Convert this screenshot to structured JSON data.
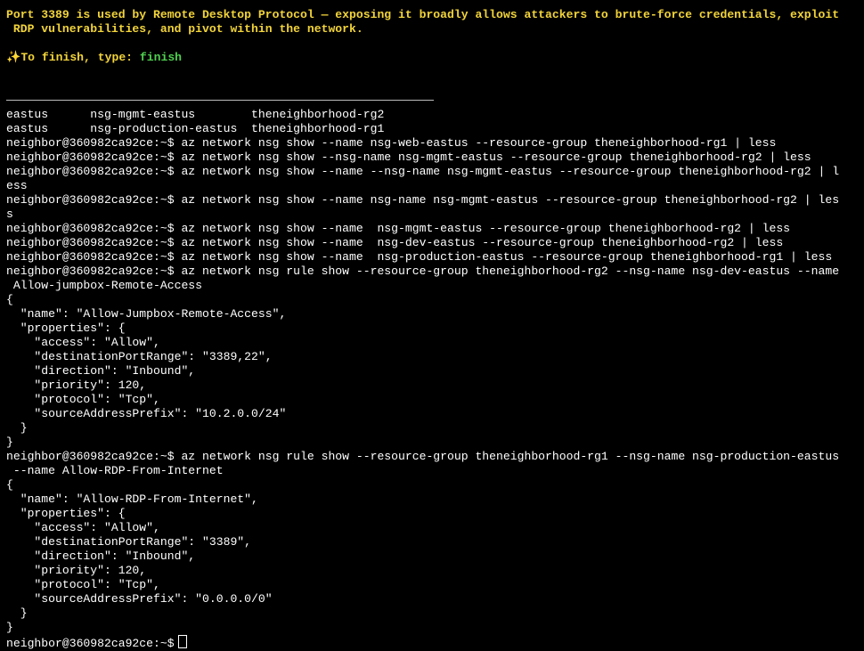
{
  "colors": {
    "background": "#000000",
    "banner_text": "#f2d43a",
    "finish_command": "#4fd04f",
    "output_text": "#ffffff"
  },
  "banner": {
    "message": "Port 3389 is used by Remote Desktop Protocol — exposing it broadly allows attackers to brute-force credentials, exploit\n RDP vulnerabilities, and pivot within the network.",
    "finish_icon": "✨",
    "finish_prefix": "To finish, type: ",
    "finish_command": "finish"
  },
  "terminal": {
    "lines": [
      "eastus      nsg-mgmt-eastus        theneighborhood-rg2",
      "eastus      nsg-production-eastus  theneighborhood-rg1",
      "neighbor@360982ca92ce:~$ az network nsg show --name nsg-web-eastus --resource-group theneighborhood-rg1 | less",
      "neighbor@360982ca92ce:~$ az network nsg show --nsg-name nsg-mgmt-eastus --resource-group theneighborhood-rg2 | less",
      "neighbor@360982ca92ce:~$ az network nsg show --name --nsg-name nsg-mgmt-eastus --resource-group theneighborhood-rg2 | l",
      "ess",
      "neighbor@360982ca92ce:~$ az network nsg show --name nsg-name nsg-mgmt-eastus --resource-group theneighborhood-rg2 | les",
      "s",
      "neighbor@360982ca92ce:~$ az network nsg show --name  nsg-mgmt-eastus --resource-group theneighborhood-rg2 | less",
      "neighbor@360982ca92ce:~$ az network nsg show --name  nsg-dev-eastus --resource-group theneighborhood-rg2 | less",
      "neighbor@360982ca92ce:~$ az network nsg show --name  nsg-production-eastus --resource-group theneighborhood-rg1 | less",
      "neighbor@360982ca92ce:~$ az network nsg rule show --resource-group theneighborhood-rg2 --nsg-name nsg-dev-eastus --name",
      " Allow-jumpbox-Remote-Access",
      "{",
      "  \"name\": \"Allow-Jumpbox-Remote-Access\",",
      "  \"properties\": {",
      "    \"access\": \"Allow\",",
      "    \"destinationPortRange\": \"3389,22\",",
      "    \"direction\": \"Inbound\",",
      "    \"priority\": 120,",
      "    \"protocol\": \"Tcp\",",
      "    \"sourceAddressPrefix\": \"10.2.0.0/24\"",
      "  }",
      "}",
      "neighbor@360982ca92ce:~$ az network nsg rule show --resource-group theneighborhood-rg1 --nsg-name nsg-production-eastus",
      " --name Allow-RDP-From-Internet",
      "{",
      "  \"name\": \"Allow-RDP-From-Internet\",",
      "  \"properties\": {",
      "    \"access\": \"Allow\",",
      "    \"destinationPortRange\": \"3389\",",
      "    \"direction\": \"Inbound\",",
      "    \"priority\": 120,",
      "    \"protocol\": \"Tcp\",",
      "    \"sourceAddressPrefix\": \"0.0.0.0/0\"",
      "  }",
      "}"
    ],
    "prompt": "neighbor@360982ca92ce:~$"
  }
}
